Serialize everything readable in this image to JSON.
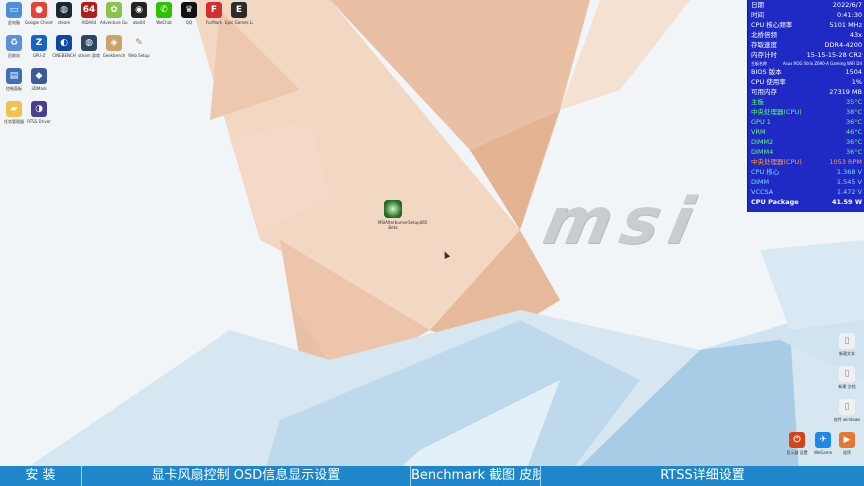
{
  "wallpaper": {
    "logo_text": "msi"
  },
  "desktop_icons": [
    {
      "label": "此电脑",
      "icon": "computer-icon",
      "color": "#4a90d9",
      "glyph": "▭"
    },
    {
      "label": "Google Chrome",
      "icon": "chrome-icon",
      "color": "#e94235",
      "glyph": "●"
    },
    {
      "label": "steam",
      "icon": "steam-icon",
      "color": "#1b2838",
      "glyph": "◍"
    },
    {
      "label": "AIDA64",
      "icon": "aida64-icon",
      "color": "#b71c1c",
      "glyph": "64"
    },
    {
      "label": "Adventure Guide",
      "icon": "adventure-icon",
      "color": "#8bc34a",
      "glyph": "✿"
    },
    {
      "label": "obs64",
      "icon": "obs-icon",
      "color": "#222222",
      "glyph": "◉"
    },
    {
      "label": "WeChat",
      "icon": "wechat-icon",
      "color": "#2dc100",
      "glyph": "✆"
    },
    {
      "label": "QQ",
      "icon": "qq-icon",
      "color": "#111111",
      "glyph": "♛"
    },
    {
      "label": "FurMark",
      "icon": "furmark-icon",
      "color": "#d32f2f",
      "glyph": "F"
    },
    {
      "label": "Epic Games Launcher",
      "icon": "epic-icon",
      "color": "#2b2b2b",
      "glyph": "E"
    },
    {
      "label": "回收站",
      "icon": "recycle-bin-icon",
      "color": "#5b8fd6",
      "glyph": "♻"
    },
    {
      "label": "GPU-Z",
      "icon": "gpuz-icon",
      "color": "#1565c0",
      "glyph": "Z"
    },
    {
      "label": "CINEBENCH",
      "icon": "cinebench-icon",
      "color": "#0d47a1",
      "glyph": "◐"
    },
    {
      "label": "steam 游戏",
      "icon": "steam-game-icon",
      "color": "#2a475e",
      "glyph": "◍"
    },
    {
      "label": "Geekbench",
      "icon": "geekbench-icon",
      "color": "#c9a36a",
      "glyph": "◈"
    },
    {
      "label": "Web Setup",
      "icon": "setup-icon",
      "color": "#f5f5f5",
      "glyph": "✎"
    },
    {
      "label": "控制面板",
      "icon": "control-panel-icon",
      "color": "#3f6fb5",
      "glyph": "▤"
    },
    {
      "label": "3DMark",
      "icon": "3dmark-icon",
      "color": "#3c5a99",
      "glyph": "◆"
    },
    {
      "label": "任务管理器",
      "icon": "folder-icon",
      "color": "#f2c14e",
      "glyph": "▰"
    },
    {
      "label": "RTSS Driver",
      "icon": "rtss-icon",
      "color": "#4a3f8c",
      "glyph": "◑"
    }
  ],
  "center_file": {
    "label": "MSIAfterburnerSetup465 Beta"
  },
  "right_icons": [
    {
      "label": "新建文本",
      "icon": "text-file-icon",
      "color": "#f0f0f0",
      "glyph": "▯"
    },
    {
      "label": "新建 文档",
      "icon": "doc-file-icon",
      "color": "#f0f0f0",
      "glyph": "▯"
    },
    {
      "label": "软件 windows",
      "icon": "file-icon",
      "color": "#f0f0f0",
      "glyph": "▯"
    },
    {
      "label": "程序",
      "icon": "app-icon",
      "color": "#e8772e",
      "glyph": "▶"
    }
  ],
  "bottom_right_icons": [
    {
      "label": "显示器 设置",
      "icon": "power-icon",
      "color": "#d84315",
      "glyph": "⏻"
    },
    {
      "label": "WeGame",
      "icon": "wegame-icon",
      "color": "#1e88e5",
      "glyph": "✈"
    }
  ],
  "osd": {
    "rows": [
      {
        "label": "日期",
        "value": "2022/6/7",
        "color": "white"
      },
      {
        "label": "时间",
        "value": "0:41:30",
        "color": "white"
      },
      {
        "label": "CPU 核心频率",
        "value": "5101 MHz",
        "color": "white"
      },
      {
        "label": "北桥倍频",
        "value": "43x",
        "color": "white"
      },
      {
        "label": "存取速度",
        "value": "DDR4-4200",
        "color": "white"
      },
      {
        "label": "内存计时",
        "value": "15-15-15-28 CR2",
        "color": "white"
      },
      {
        "label": "主板名称",
        "value": "Asus ROG Strix Z690-A Gaming WiFi D4",
        "color": "white",
        "small": true
      },
      {
        "label": "BIOS 版本",
        "value": "1504",
        "color": "white"
      },
      {
        "label": "CPU 使用率",
        "value": "1%",
        "color": "white"
      },
      {
        "label": "可用内存",
        "value": "27319 MB",
        "color": "white"
      },
      {
        "label": "主板",
        "value": "35°C",
        "color": "green"
      },
      {
        "label": "中央处理器(CPU)",
        "value": "38°C",
        "color": "green"
      },
      {
        "label": "GPU 1",
        "value": "36°C",
        "color": "green"
      },
      {
        "label": "VRM",
        "value": "46°C",
        "color": "green"
      },
      {
        "label": "DIMM2",
        "value": "36°C",
        "color": "green"
      },
      {
        "label": "DIMM4",
        "value": "36°C",
        "color": "green"
      },
      {
        "label": "中央处理器(CPU)",
        "value": "1053 RPM",
        "color": "orange"
      },
      {
        "label": "CPU 核心",
        "value": "1.368 V",
        "color": "cyan"
      },
      {
        "label": "DIMM",
        "value": "1.545 V",
        "color": "cyan"
      },
      {
        "label": "VCCSA",
        "value": "1.472 V",
        "color": "cyan"
      },
      {
        "label": "CPU Package",
        "value": "41.59 W",
        "color": "white",
        "bold": true
      }
    ]
  },
  "bottom_bar": {
    "items": [
      {
        "label": "安 装",
        "name": "install-tab"
      },
      {
        "label": "显卡风扇控制  OSD信息显示设置",
        "name": "fan-osd-tab"
      },
      {
        "label": "Benchmark 截图 皮肤",
        "name": "benchmark-tab"
      },
      {
        "label": "RTSS详细设置",
        "name": "rtss-tab"
      }
    ]
  }
}
